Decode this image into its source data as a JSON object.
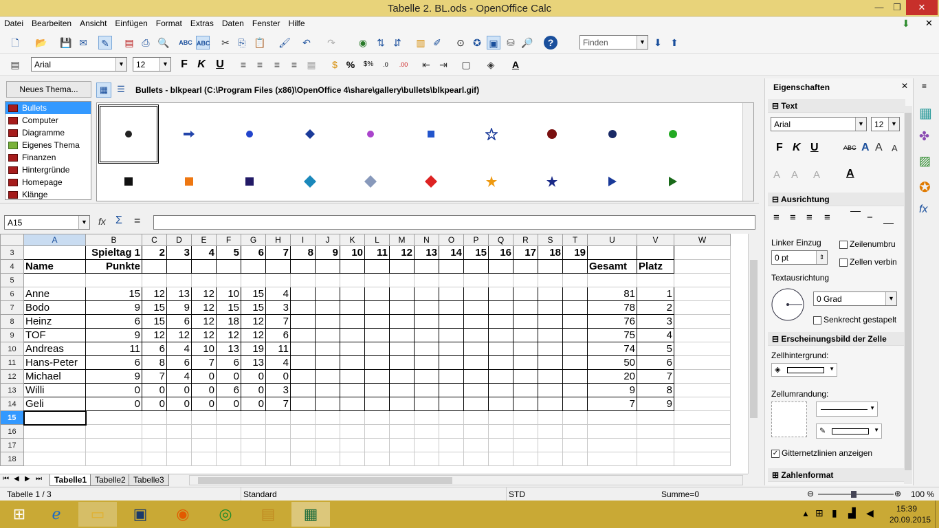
{
  "window": {
    "title": "Tabelle 2. BL.ods - OpenOffice Calc"
  },
  "menu": [
    "Datei",
    "Bearbeiten",
    "Ansicht",
    "Einfügen",
    "Format",
    "Extras",
    "Daten",
    "Fenster",
    "Hilfe"
  ],
  "toolbar": {
    "find_placeholder": "Finden",
    "font_name": "Arial",
    "font_size": "12"
  },
  "gallery": {
    "new_theme_label": "Neues Thema...",
    "path": "Bullets - blkpearl (C:\\Program Files (x86)\\OpenOffice 4\\share\\gallery\\bullets\\blkpearl.gif)",
    "themes": [
      "Bullets",
      "Computer",
      "Diagramme",
      "Eigenes Thema",
      "Finanzen",
      "Hintergründe",
      "Homepage",
      "Klänge"
    ]
  },
  "formula": {
    "cell_ref": "A15",
    "content": ""
  },
  "columns": [
    "A",
    "B",
    "C",
    "D",
    "E",
    "F",
    "G",
    "H",
    "I",
    "J",
    "K",
    "L",
    "M",
    "N",
    "O",
    "P",
    "Q",
    "R",
    "S",
    "T",
    "U",
    "V",
    "W"
  ],
  "rows": [
    {
      "n": "3",
      "cells": [
        "",
        "Spieltag 1",
        "2",
        "3",
        "4",
        "5",
        "6",
        "7",
        "8",
        "9",
        "10",
        "11",
        "12",
        "13",
        "14",
        "15",
        "16",
        "17",
        "18",
        "19",
        "",
        "",
        ""
      ]
    },
    {
      "n": "4",
      "cells": [
        "Name",
        "Punkte",
        "",
        "",
        "",
        "",
        "",
        "",
        "",
        "",
        "",
        "",
        "",
        "",
        "",
        "",
        "",
        "",
        "",
        "",
        "Gesamt",
        "Platz",
        ""
      ]
    },
    {
      "n": "5",
      "cells": [
        "",
        "",
        "",
        "",
        "",
        "",
        "",
        "",
        "",
        "",
        "",
        "",
        "",
        "",
        "",
        "",
        "",
        "",
        "",
        "",
        "",
        "",
        ""
      ]
    },
    {
      "n": "6",
      "cells": [
        "Anne",
        "15",
        "12",
        "13",
        "12",
        "10",
        "15",
        "4",
        "",
        "",
        "",
        "",
        "",
        "",
        "",
        "",
        "",
        "",
        "",
        "",
        "81",
        "1",
        ""
      ]
    },
    {
      "n": "7",
      "cells": [
        "Bodo",
        "9",
        "15",
        "9",
        "12",
        "15",
        "15",
        "3",
        "",
        "",
        "",
        "",
        "",
        "",
        "",
        "",
        "",
        "",
        "",
        "",
        "78",
        "2",
        ""
      ]
    },
    {
      "n": "8",
      "cells": [
        "Heinz",
        "6",
        "15",
        "6",
        "12",
        "18",
        "12",
        "7",
        "",
        "",
        "",
        "",
        "",
        "",
        "",
        "",
        "",
        "",
        "",
        "",
        "76",
        "3",
        ""
      ]
    },
    {
      "n": "9",
      "cells": [
        "TOF",
        "9",
        "12",
        "12",
        "12",
        "12",
        "12",
        "6",
        "",
        "",
        "",
        "",
        "",
        "",
        "",
        "",
        "",
        "",
        "",
        "",
        "75",
        "4",
        ""
      ]
    },
    {
      "n": "10",
      "cells": [
        "Andreas",
        "11",
        "6",
        "4",
        "10",
        "13",
        "19",
        "11",
        "",
        "",
        "",
        "",
        "",
        "",
        "",
        "",
        "",
        "",
        "",
        "",
        "74",
        "5",
        ""
      ]
    },
    {
      "n": "11",
      "cells": [
        "Hans-Peter",
        "6",
        "8",
        "6",
        "7",
        "6",
        "13",
        "4",
        "",
        "",
        "",
        "",
        "",
        "",
        "",
        "",
        "",
        "",
        "",
        "",
        "50",
        "6",
        ""
      ]
    },
    {
      "n": "12",
      "cells": [
        "Michael",
        "9",
        "7",
        "4",
        "0",
        "0",
        "0",
        "0",
        "",
        "",
        "",
        "",
        "",
        "",
        "",
        "",
        "",
        "",
        "",
        "",
        "20",
        "7",
        ""
      ]
    },
    {
      "n": "13",
      "cells": [
        "Willi",
        "0",
        "0",
        "0",
        "0",
        "6",
        "0",
        "3",
        "",
        "",
        "",
        "",
        "",
        "",
        "",
        "",
        "",
        "",
        "",
        "",
        "9",
        "8",
        ""
      ]
    },
    {
      "n": "14",
      "cells": [
        "Geli",
        "0",
        "0",
        "0",
        "0",
        "0",
        "0",
        "7",
        "",
        "",
        "",
        "",
        "",
        "",
        "",
        "",
        "",
        "",
        "",
        "",
        "7",
        "9",
        ""
      ]
    },
    {
      "n": "15",
      "cells": [
        "",
        "",
        "",
        "",
        "",
        "",
        "",
        "",
        "",
        "",
        "",
        "",
        "",
        "",
        "",
        "",
        "",
        "",
        "",
        "",
        "",
        "",
        ""
      ]
    },
    {
      "n": "16",
      "cells": [
        "",
        "",
        "",
        "",
        "",
        "",
        "",
        "",
        "",
        "",
        "",
        "",
        "",
        "",
        "",
        "",
        "",
        "",
        "",
        "",
        "",
        "",
        ""
      ]
    },
    {
      "n": "17",
      "cells": [
        "",
        "",
        "",
        "",
        "",
        "",
        "",
        "",
        "",
        "",
        "",
        "",
        "",
        "",
        "",
        "",
        "",
        "",
        "",
        "",
        "",
        "",
        ""
      ]
    },
    {
      "n": "18",
      "cells": [
        "",
        "",
        "",
        "",
        "",
        "",
        "",
        "",
        "",
        "",
        "",
        "",
        "",
        "",
        "",
        "",
        "",
        "",
        "",
        "",
        "",
        "",
        ""
      ]
    }
  ],
  "sheets": [
    "Tabelle1",
    "Tabelle2",
    "Tabelle3"
  ],
  "status": {
    "sheet": "Tabelle 1 / 3",
    "style": "Standard",
    "mode": "STD",
    "sum": "Summe=0",
    "zoom": "100 %"
  },
  "sidebar": {
    "title": "Eigenschaften",
    "text_section": "Text",
    "font": "Arial",
    "size": "12",
    "align_section": "Ausrichtung",
    "indent_label": "Linker Einzug",
    "indent_value": "0 pt",
    "wrap_label": "Zeilenumbru",
    "merge_label": "Zellen verbin",
    "orient_label": "Textausrichtung",
    "angle": "0 Grad",
    "stacked_label": "Senkrecht gestapelt",
    "cell_section": "Erscheinungsbild der Zelle",
    "bg_label": "Zellhintergrund:",
    "border_label": "Zellumrandung:",
    "gridlines_label": "Gitternetzlinien anzeigen",
    "number_section": "Zahlenformat"
  },
  "taskbar": {
    "time": "15:39",
    "date": "20.09.2015"
  }
}
